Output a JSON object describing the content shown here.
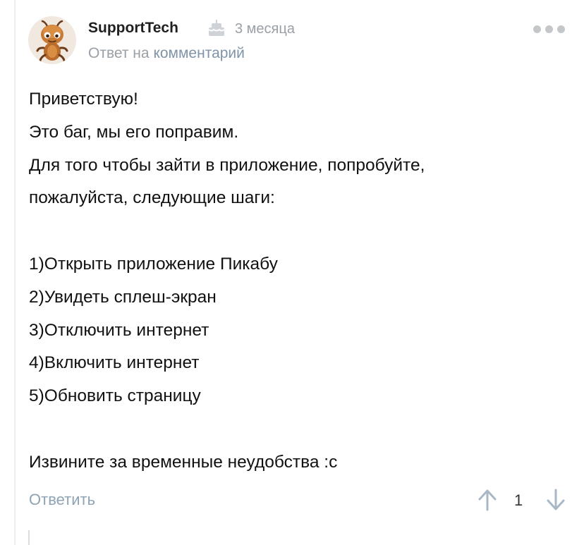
{
  "comment": {
    "author": "SupportTech",
    "time": "3 месяца",
    "reply_prefix": "Ответ на",
    "reply_link": "комментарий",
    "lines": [
      "Приветствую!",
      "Это баг, мы его поправим.",
      "Для того чтобы зайти в приложение, попробуйте,",
      "пожалуйста,  следующие шаги:",
      "",
      "1)Открыть приложение Пикабу",
      "2)Увидеть сплеш-экран",
      "3)Отключить интернет",
      "4)Включить интернет",
      "5)Обновить страницу",
      "",
      "Извините за временные неудобства :с"
    ]
  },
  "actions": {
    "reply_label": "Ответить",
    "rating": "1"
  },
  "icons": {
    "avatar": "cartoon-character-avatar",
    "badge": "cake-icon",
    "more": "more-dots-icon",
    "upvote": "arrow-up-icon",
    "downvote": "arrow-down-icon"
  },
  "colors": {
    "link": "#7f94a8",
    "muted": "#9aa0a6",
    "reply": "#8ea3b3",
    "vote": "#a8b8c6"
  }
}
